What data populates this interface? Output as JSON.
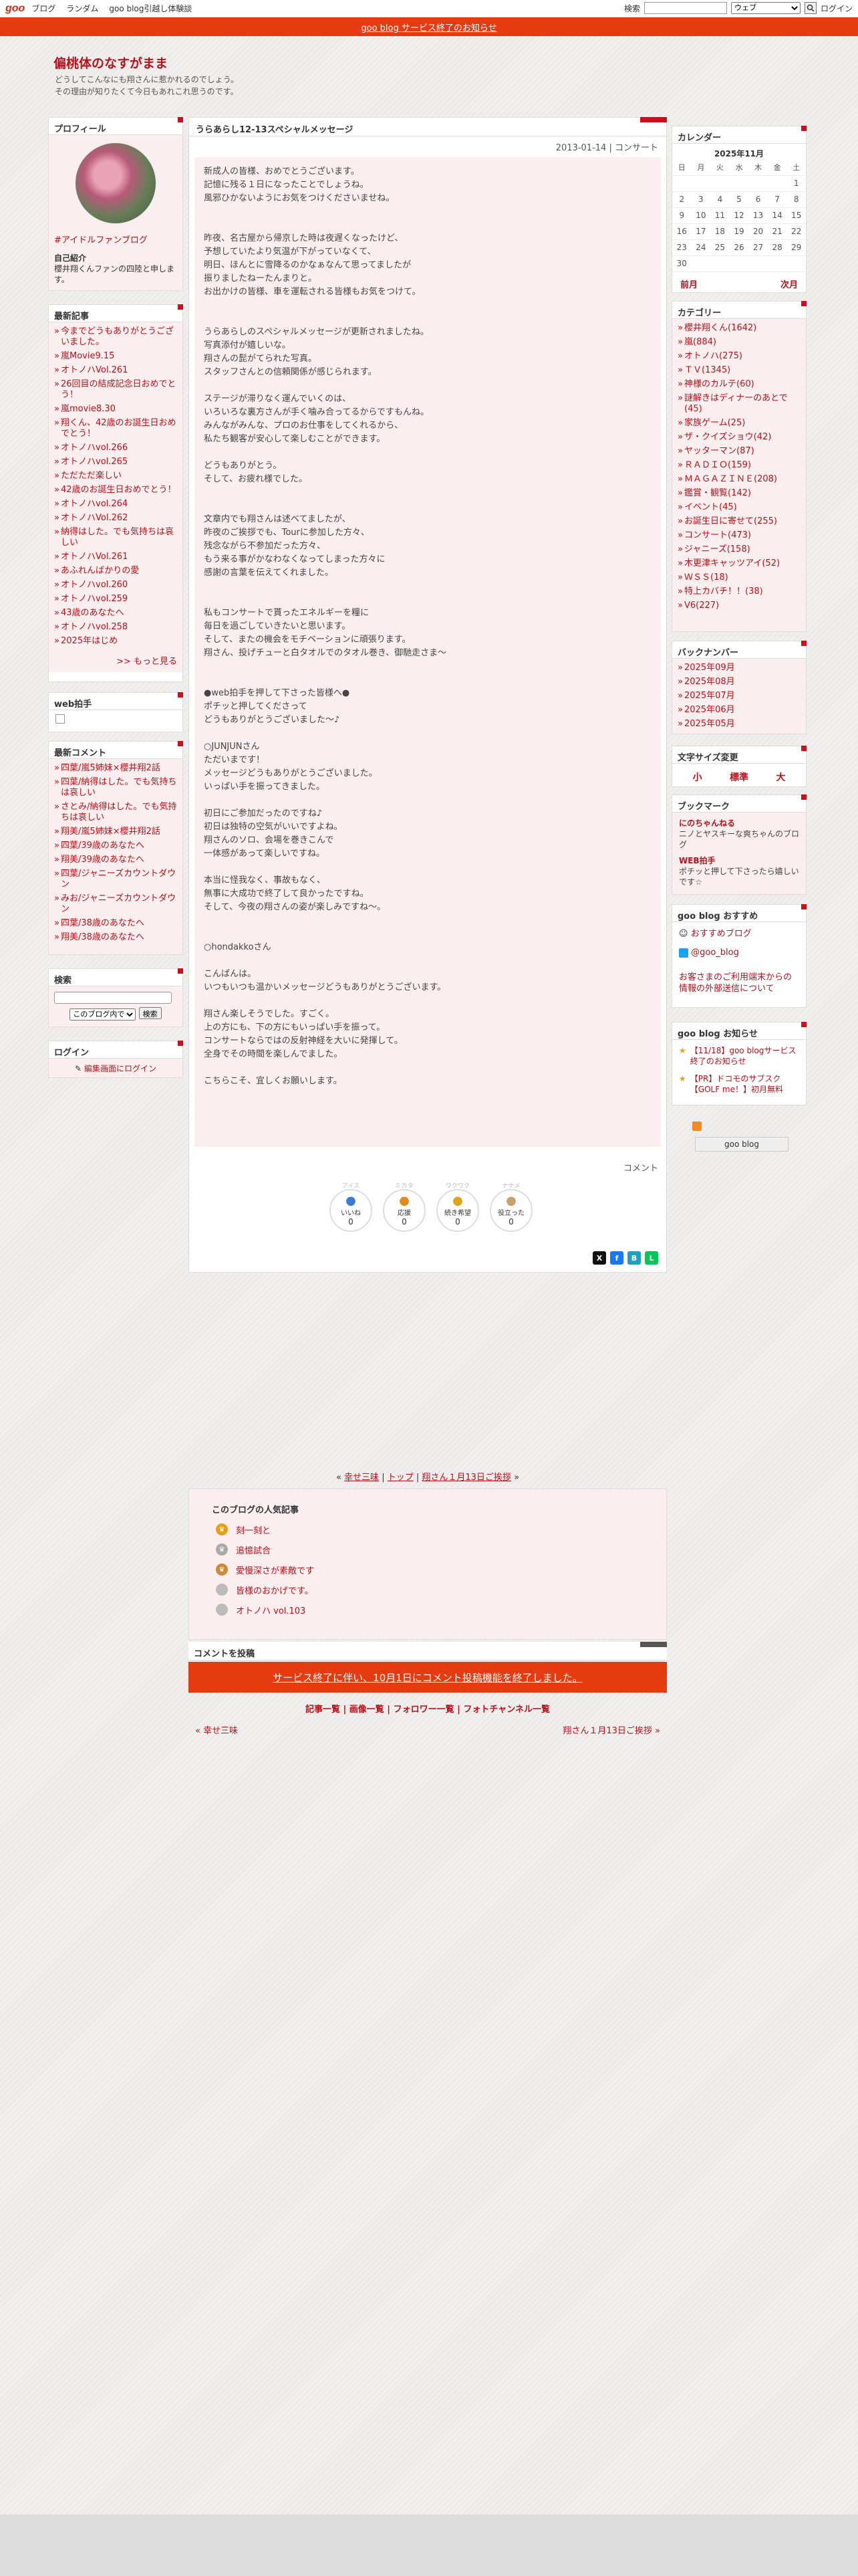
{
  "topbar": {
    "logo": "goo",
    "links": [
      "ブログ",
      "ランダム",
      "goo blog引越し体験談"
    ],
    "search_label": "検索",
    "search_value": "",
    "search_scope": "ウェブ",
    "login": "ログイン"
  },
  "notice": "goo blog サービス終了のお知らせ",
  "blog": {
    "title": "偏桃体のなすがまま",
    "desc1": "どうしてこんなにも翔さんに惹かれるのでしょう。",
    "desc2": "その理由が知りたくて今日もあれこれ思うのです。"
  },
  "profile": {
    "header": "プロフィール",
    "link": "#アイドルファンブログ",
    "intro_label": "自己紹介",
    "intro": "櫻井翔くんファンの四陸と申します。"
  },
  "recent": {
    "header": "最新記事",
    "items": [
      "今までどうもありがとうございました。",
      "嵐Movie9.15",
      "オトノハVol.261",
      "26回目の結成記念日おめでとう！",
      "嵐movie8.30",
      "翔くん、42歳のお誕生日おめでとう！",
      "オトノハvol.266",
      "オトノハvol.265",
      "ただただ楽しい",
      "42歳のお誕生日おめでとう！",
      "オトノハvol.264",
      "オトノハVol.262",
      "納得はした。でも気持ちは哀しい",
      "オトノハVol.261",
      "あふれんばかりの愛",
      "オトノハvol.260",
      "オトノハvol.259",
      "43歳のあなたへ",
      "オトノハvol.258",
      "2025年はじめ"
    ],
    "more": ">> もっと見る"
  },
  "clap": {
    "header": "web拍手"
  },
  "comments": {
    "header": "最新コメント",
    "items": [
      "四葉/嵐5姉妹×櫻井翔2話",
      "四葉/納得はした。でも気持ちは哀しい",
      "さとみ/納得はした。でも気持ちは哀しい",
      "翔美/嵐5姉妹×櫻井翔2話",
      "四葉/39歳のあなたへ",
      "翔美/39歳のあなたへ",
      "四葉/ジャニーズカウントダウン",
      "みお/ジャニーズカウントダウン",
      "四葉/38歳のあなたへ",
      "翔美/38歳のあなたへ"
    ]
  },
  "search": {
    "header": "検索",
    "input": "",
    "scope": "このブログ内で",
    "button": "検索"
  },
  "login": {
    "header": "ログイン",
    "link": "編集画面にログイン"
  },
  "post": {
    "title": "うらあらし12-13スペシャルメッセージ",
    "date": "2013-01-14",
    "comment": "コンサート",
    "paragraphs": [
      "新成人の皆様、おめでとうございます。\n記憶に残る１日になったことでしょうね。\n風邪ひかないようにお気をつけくださいませね。",
      "\n昨夜、名古屋から帰京した時は夜遅くなったけど、\n予想していたより気温が下がっていなくて、\n明日、ほんとに雪降るのかなぁなんて思ってましたが\n振りましたねーたんまりと。\nお出かけの皆様、車を運転される皆様もお気をつけて。",
      "\nうらあらしのスペシャルメッセージが更新されましたね。\n写真添付が嬉しいな。\n翔さんの髭がてられた写真。\nスタッフさんとの信頼関係が感じられます。",
      "ステージが滞りなく運んでいくのは、\nいろいろな裏方さんが手く噛み合ってるからですもんね。\nみんながみんな、プロのお仕事をしてくれるから、\n私たち観客が安心して楽しむことができます。",
      "どうもありがとう。\nそして、お疲れ様でした。",
      "\n文章内でも翔さんは述べてましたが、\n昨夜のご挨拶でも、Tourに参加した方々、\n残念ながら不参加だった方々、\nもう来る事がかなわなくなってしまった方々に\n感謝の言葉を伝えてくれました。",
      "\n私もコンサートで貰ったエネルギーを糧に\n毎日を過ごしていきたいと思います。\nそして、またの機会をモチベーションに頑張ります。\n翔さん、投げチューと白タオルでのタオル巻き、御馳走さま～",
      "\n●web拍手を押して下さった皆様へ●\nポチッと押してくださって\nどうもありがとうございました～♪",
      "○JUNJUNさん\nただいまです！\nメッセージどうもありがとうございました。\nいっぱい手を振ってきました。",
      "初日にご参加だったのですね♪\n初日は独特の空気がいいですよね。\n翔さんのソロ、会場を巻きこんで\n一体感があって楽しいですね。",
      "本当に怪我なく、事故もなく、\n無事に大成功で終了して良かったですね。\nそして、今夜の翔さんの姿が楽しみですね～。",
      "\n○hondakkoさん",
      "こんばんは。\nいつもいつも温かいメッセージどうもありがとうございます。",
      "翔さん楽しそうでした。すごく。\n上の方にも、下の方にもいっぱい手を振って。\nコンサートならではの反射神経を大いに発揮して。\n全身でその時間を楽しんでました。",
      "こちらこそ、宜しくお願いします。"
    ],
    "comment_link": "コメント",
    "reactions": [
      {
        "top": "アイス",
        "label": "いいね",
        "count": "0",
        "color": "#3b7bd6"
      },
      {
        "top": "ミカタ",
        "label": "応援",
        "count": "0",
        "color": "#e08b1d"
      },
      {
        "top": "ワクワク",
        "label": "続き希望",
        "count": "0",
        "color": "#e0a21d"
      },
      {
        "top": "ナナメ",
        "label": "役立った",
        "count": "0",
        "color": "#c9a06b"
      }
    ]
  },
  "nav": {
    "prev": "幸せ三味",
    "top": "トップ",
    "next": "翔さん１月13日ご挨拶"
  },
  "popular": {
    "title": "このブログの人気記事",
    "items": [
      "刻一刻と",
      "追憶試合",
      "愛慢深さが素敵です",
      "皆様のおかげです。",
      "オトノハ vol.103"
    ]
  },
  "postcomment": {
    "header": "コメントを投稿",
    "notice": "サービス終了に伴い、10月1日にコメント投稿機能を終了しました。"
  },
  "footer": {
    "links": "記事一覧 | 画像一覧 | フォロワー一覧 | フォトチャンネル一覧",
    "prev": "« 幸せ三味",
    "next": "翔さん１月13日ご挨拶 »"
  },
  "calendar": {
    "header": "カレンダー",
    "month": "2025年11月",
    "days": [
      "日",
      "月",
      "火",
      "水",
      "木",
      "金",
      "土"
    ],
    "rows": [
      [
        "",
        "",
        "",
        "",
        "",
        "",
        "1"
      ],
      [
        "2",
        "3",
        "4",
        "5",
        "6",
        "7",
        "8"
      ],
      [
        "9",
        "10",
        "11",
        "12",
        "13",
        "14",
        "15"
      ],
      [
        "16",
        "17",
        "18",
        "19",
        "20",
        "21",
        "22"
      ],
      [
        "23",
        "24",
        "25",
        "26",
        "27",
        "28",
        "29"
      ],
      [
        "30",
        "",
        "",
        "",
        "",
        "",
        ""
      ]
    ],
    "prev": "前月",
    "next": "次月"
  },
  "categories": {
    "header": "カテゴリー",
    "items": [
      "櫻井翔くん(1642)",
      "嵐(884)",
      "オトノハ(275)",
      "ＴＶ(1345)",
      "神様のカルテ(60)",
      "謎解きはディナーのあとで(45)",
      "家族ゲーム(25)",
      "ザ・クイズショウ(42)",
      "ヤッターマン(87)",
      "ＲＡＤＩＯ(159)",
      "ＭＡＧＡＺＩＮＥ(208)",
      "鑑賞・観覧(142)",
      "イベント(45)",
      "お誕生日に寄せて(255)",
      "コンサート(473)",
      "ジャニーズ(158)",
      "木更津キャッツアイ(52)",
      "ＷＳＳ(18)",
      "特上カバチ！！(38)",
      "V6(227)"
    ]
  },
  "backnumber": {
    "header": "バックナンバー",
    "items": [
      "2025年09月",
      "2025年08月",
      "2025年07月",
      "2025年06月",
      "2025年05月"
    ]
  },
  "fontsize": {
    "header": "文字サイズ変更",
    "small": "小",
    "mid": "標準",
    "large": "大"
  },
  "bookmark": {
    "header": "ブックマーク",
    "items": [
      {
        "t": "にのちゃんねる",
        "d": "ニノとヤスキーな爽ちゃんのブログ"
      },
      {
        "t": "WEB拍手",
        "d": "ポチッと押して下さったら嬉しいです☆"
      }
    ]
  },
  "recommend": {
    "header": "goo blog おすすめ",
    "item1": "おすすめブログ",
    "item2": "@goo_blog",
    "item3": "お客さまのご利用端末からの情報の外部送信について"
  },
  "news": {
    "header": "goo blog お知らせ",
    "item1": "【11/18】goo blogサービス終了のお知らせ",
    "item2": "【PR】ドコモのサブスク【GOLF me！】初月無料"
  },
  "goobutton": "goo blog",
  "colors": {
    "accent": "#b8111b",
    "notice": "#e63a10"
  }
}
